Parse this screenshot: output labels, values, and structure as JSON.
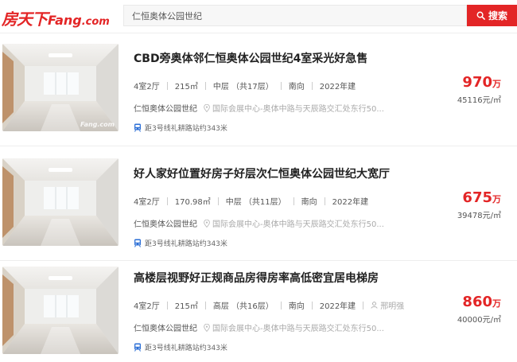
{
  "header": {
    "logo_cn": "房天下",
    "logo_en": "Fang",
    "logo_dot": ".com",
    "search_value": "仁恒奥体公园世纪",
    "search_button_label": "搜索"
  },
  "listings": [
    {
      "title": "CBD旁奥体邻仁恒奥体公园世纪4室采光好急售",
      "layout": "4室2厅",
      "area": "215㎡",
      "floor": "中层 （共17层）",
      "orientation": "南向",
      "year": "2022年建",
      "agent": "",
      "community": "仁恒奥体公园世纪",
      "address": "国际会展中心-奥体中路与天辰路交汇处东行50...",
      "metro": "距3号线礼耕路站约343米",
      "price_total": "970",
      "price_unit": "万",
      "price_per": "45116元/㎡",
      "watermark": "Fang.com"
    },
    {
      "title": "好人家好位置好房子好层次仁恒奥体公园世纪大宽厅",
      "layout": "4室2厅",
      "area": "170.98㎡",
      "floor": "中层 （共11层）",
      "orientation": "南向",
      "year": "2022年建",
      "agent": "",
      "community": "仁恒奥体公园世纪",
      "address": "国际会展中心-奥体中路与天辰路交汇处东行50...",
      "metro": "距3号线礼耕路站约343米",
      "price_total": "675",
      "price_unit": "万",
      "price_per": "39478元/㎡",
      "watermark": ""
    },
    {
      "title": "高楼层视野好正规商品房得房率高低密宜居电梯房",
      "layout": "4室2厅",
      "area": "215㎡",
      "floor": "高层 （共16层）",
      "orientation": "南向",
      "year": "2022年建",
      "agent": "邢明强",
      "community": "仁恒奥体公园世纪",
      "address": "国际会展中心-奥体中路与天辰路交汇处东行50...",
      "metro": "距3号线礼耕路站约343米",
      "price_total": "860",
      "price_unit": "万",
      "price_per": "40000元/㎡",
      "watermark": ""
    }
  ],
  "colors": {
    "brand_red": "#e32526",
    "metro_blue": "#2c6fd6"
  }
}
